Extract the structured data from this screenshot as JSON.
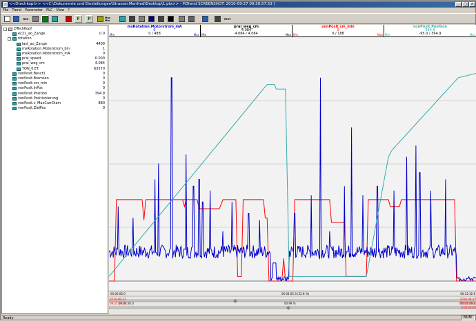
{
  "window": {
    "title": "<<Dtechkopf>> <<C:\\Dokumente und Einstellungen\\Strasser.Manfred\\Desktop\\1.ptx>> - PLTrend   SCREENSHOT: 2010-09-27 09:30:57.53 ]",
    "minimize": "_",
    "maximize": "□",
    "close": "×"
  },
  "menu": [
    "File",
    "Trend",
    "Parameter",
    "PLC",
    "View",
    "?"
  ],
  "toolbar": {
    "buttons": [
      {
        "name": "new-icon",
        "label": ""
      },
      {
        "name": "save-icon",
        "label": ""
      },
      {
        "name": "open-rec-icon",
        "label": "REC"
      },
      {
        "name": "layout-icon",
        "label": ""
      },
      {
        "name": "play-icon",
        "label": ""
      },
      {
        "name": "scope-icon",
        "label": ""
      },
      {
        "name": "record-icon",
        "label": ""
      },
      {
        "name": "flag-icon",
        "label": "F"
      },
      {
        "name": "pause-icon",
        "label": "P"
      },
      {
        "name": "marker-icon",
        "label": ""
      },
      {
        "name": "max-min-icon",
        "label": "Max Min"
      },
      {
        "name": "chart-icon",
        "label": ""
      },
      {
        "name": "cursor-icon",
        "label": ""
      },
      {
        "name": "zoom-icon",
        "label": ""
      },
      {
        "name": "trigger-icon",
        "label": ""
      },
      {
        "name": "print-icon",
        "label": ""
      },
      {
        "name": "close-x-icon",
        "label": ""
      },
      {
        "name": "grid-icon",
        "label": ""
      },
      {
        "name": "table-icon",
        "label": ""
      },
      {
        "name": "arrows-icon",
        "label": ""
      },
      {
        "name": "wheel-icon",
        "label": ""
      },
      {
        "name": "text-icon",
        "label": "TEXT"
      }
    ]
  },
  "tree": {
    "rows": [
      {
        "label": "DTechKopf",
        "value": "",
        "indent": 0,
        "expander": "-"
      },
      {
        "label": "ec21_ao_Zange",
        "value": "0.0",
        "indent": 1,
        "expander": ""
      },
      {
        "label": "rotation",
        "value": "",
        "indent": 1,
        "expander": "-"
      },
      {
        "label": "last_ao_Zange",
        "value": "4400",
        "indent": 2,
        "expander": ""
      },
      {
        "label": "msRotation.Motorstrom_bin",
        "value": "1",
        "indent": 2,
        "expander": ""
      },
      {
        "label": "msRotation.Motorstrom_mA",
        "value": "0",
        "indent": 2,
        "expander": ""
      },
      {
        "label": "prai_speed",
        "value": "0.000",
        "indent": 2,
        "expander": ""
      },
      {
        "label": "prai_weg_cm",
        "value": "4.084",
        "indent": 2,
        "expander": ""
      },
      {
        "label": "TON_0.ET",
        "value": "63570",
        "indent": 2,
        "expander": ""
      },
      {
        "label": "vonPosit.Beschl",
        "value": "0",
        "indent": 1,
        "expander": ""
      },
      {
        "label": "vonPosit.Bremsen",
        "value": "0",
        "indent": 1,
        "expander": ""
      },
      {
        "label": "vonPosit.cm_min",
        "value": "0",
        "indent": 1,
        "expander": ""
      },
      {
        "label": "vonPosit.InPos",
        "value": "0",
        "indent": 1,
        "expander": ""
      },
      {
        "label": "vonPosit.Position",
        "value": "394.9",
        "indent": 1,
        "expander": ""
      },
      {
        "label": "vonPosit.Positionierung",
        "value": "0",
        "indent": 1,
        "expander": ""
      },
      {
        "label": "vonPosit.v_MaxCurrDiam",
        "value": "880",
        "indent": 1,
        "expander": ""
      },
      {
        "label": "vonPosit.ZielPos",
        "value": "0",
        "indent": 1,
        "expander": ""
      }
    ]
  },
  "channels": [
    {
      "name": "msRotation.Motorstrom_mA",
      "value": "0",
      "range": "0 / 488",
      "min": "Min",
      "max": "Max",
      "color": "#0000cc"
    },
    {
      "name": "prai_weg_cm",
      "value": "4.084",
      "range": "4.084 / 4.084",
      "min": "Min",
      "max": "Max",
      "color": "#000000"
    },
    {
      "name": "vonPosit.cm_min",
      "value": "0",
      "range": "0 / 188",
      "min": "Min",
      "max": "Max",
      "color": "#ff0000"
    },
    {
      "name": "vonPosit.Position",
      "value": "394.9",
      "range": "-95.0 / 394.9",
      "min": "Min",
      "max": "Max",
      "color": "#33aaaa"
    }
  ],
  "chart_data": {
    "type": "line",
    "title": "",
    "xlabel": "",
    "ylabel": "",
    "grid": true,
    "series": [
      {
        "name": "vonPosit.Position",
        "color": "#33aaaa",
        "points": [
          [
            0,
            0.02
          ],
          [
            0.43,
            0.87
          ],
          [
            0.45,
            0.87
          ],
          [
            0.455,
            0.85
          ],
          [
            0.48,
            0.85
          ],
          [
            0.49,
            0.02
          ],
          [
            0.7,
            0.02
          ],
          [
            0.76,
            0.55
          ],
          [
            0.77,
            0.58
          ],
          [
            0.95,
            0.9
          ],
          [
            1.0,
            0.92
          ]
        ]
      },
      {
        "name": "vonPosit.cm_min",
        "color": "#ff0000",
        "points": [
          [
            0,
            0.0
          ],
          [
            0.015,
            0.0
          ],
          [
            0.02,
            0.36
          ],
          [
            0.09,
            0.36
          ],
          [
            0.095,
            0.27
          ],
          [
            0.1,
            0.36
          ],
          [
            0.2,
            0.36
          ],
          [
            0.205,
            0.33
          ],
          [
            0.21,
            0.36
          ],
          [
            0.2,
            0.36
          ],
          [
            0.24,
            0.36
          ],
          [
            0.245,
            0.32
          ],
          [
            0.3,
            0.32
          ],
          [
            0.31,
            0.36
          ],
          [
            0.345,
            0.36
          ],
          [
            0.35,
            0.02
          ],
          [
            0.36,
            0.02
          ],
          [
            0.365,
            0.36
          ],
          [
            0.42,
            0.36
          ],
          [
            0.425,
            0.28
          ],
          [
            0.43,
            0.28
          ],
          [
            0.435,
            0.0
          ],
          [
            0.47,
            0.0
          ],
          [
            0.475,
            0.1
          ],
          [
            0.48,
            0.0
          ],
          [
            0.5,
            0.0
          ],
          [
            0.505,
            0.36
          ],
          [
            0.6,
            0.36
          ],
          [
            0.605,
            0.26
          ],
          [
            0.64,
            0.26
          ],
          [
            0.645,
            0.02
          ],
          [
            0.7,
            0.02
          ],
          [
            0.705,
            0.36
          ],
          [
            0.76,
            0.36
          ],
          [
            0.765,
            0.33
          ],
          [
            0.79,
            0.33
          ],
          [
            0.795,
            0.36
          ],
          [
            0.94,
            0.36
          ],
          [
            0.945,
            0.0
          ],
          [
            1.0,
            0.0
          ]
        ]
      },
      {
        "name": "msRotation.Motorstrom_mA",
        "color": "#0000cc"
      },
      {
        "name": "prai_weg_cm",
        "color": "#000000"
      }
    ]
  },
  "timebar": {
    "left_top": "00:00:00.0",
    "center_top": "00:04:05.3 (22.8 %)",
    "right_top": "00:12:32.8",
    "left_bottom": "00:07:20.0",
    "center_bottom": "00.99 %",
    "right_bottom": "00:11:16.2",
    "left_red1": "2010-09-27",
    "left_red2": "09:25:34:40",
    "right_red1": "2010-09-27",
    "right_red2": "09:28:06:60",
    "right_red3": "0:00:00:00"
  },
  "status": {
    "left": "Ready",
    "right": "NUM"
  }
}
